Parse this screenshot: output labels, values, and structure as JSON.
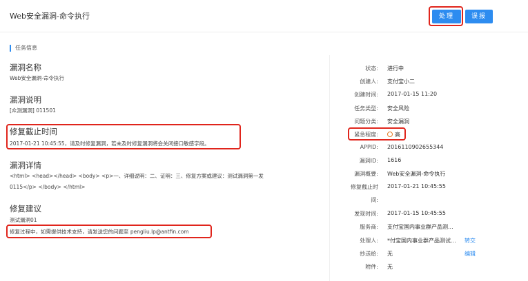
{
  "header": {
    "title": "Web安全漏洞-命令执行",
    "handle_button": "处理",
    "report_button": "误报"
  },
  "section_label": "任务信息",
  "fields": {
    "name_label": "漏洞名称",
    "name_value": "Web安全漏洞-命令执行",
    "desc_label": "漏洞说明",
    "desc_value": "[众测漏洞] 011501",
    "deadline_label": "修复截止时间",
    "deadline_value": "2017-01-21 10:45:55，请及时修复漏洞，若未及时修复漏洞将会关闭接口敏感字段。",
    "detail_label": "漏洞详情",
    "detail_line1": "<html> <head></head> <body> <p>一、详细说明：二、证明：三、修复方案或建议：测试漏洞第一发",
    "detail_line2": "0115</p> </body> </html>",
    "suggest_label": "修复建议",
    "suggest_line1": "测试漏洞01",
    "suggest_line2": "修复过程中，如需提供技术支持，请发送您的问题至 pengliu.lp@antfin.com"
  },
  "info": {
    "status_label": "状态:",
    "status_value": "进行中",
    "creator_label": "创建人:",
    "creator_value": "支付宝小二",
    "created_label": "创建时间:",
    "created_value": "2017-01-15 11:20",
    "task_type_label": "任务类型:",
    "task_type_value": "安全风险",
    "category_label": "问题分类:",
    "category_value": "安全漏洞",
    "urgency_label": "紧急程度:",
    "urgency_value": "高",
    "appid_label": "APPID:",
    "appid_value": "2016110902655344",
    "vuln_id_label": "漏洞ID:",
    "vuln_id_value": "1616",
    "summary_label": "漏洞概要:",
    "summary_value": "Web安全漏洞-命令执行",
    "deadline_label_1": "修复截止时",
    "deadline_label_2": "间:",
    "deadline_value": "2017-01-21 10:45:55",
    "found_label": "发现时间:",
    "found_value": "2017-01-15 10:45:55",
    "provider_label": "服务商:",
    "provider_value": "支付宝国内事业群产品测...",
    "handler_label": "处理人:",
    "handler_value": "*付宝国内事业群产品测试...",
    "handler_action": "转交",
    "cc_label": "抄送给:",
    "cc_value": "无",
    "cc_action": "编辑",
    "attachment_label": "附件:",
    "attachment_value": "无"
  },
  "colors": {
    "primary": "#2d8cf0",
    "highlight": "#e0251c",
    "urgency": "#e57c23"
  }
}
